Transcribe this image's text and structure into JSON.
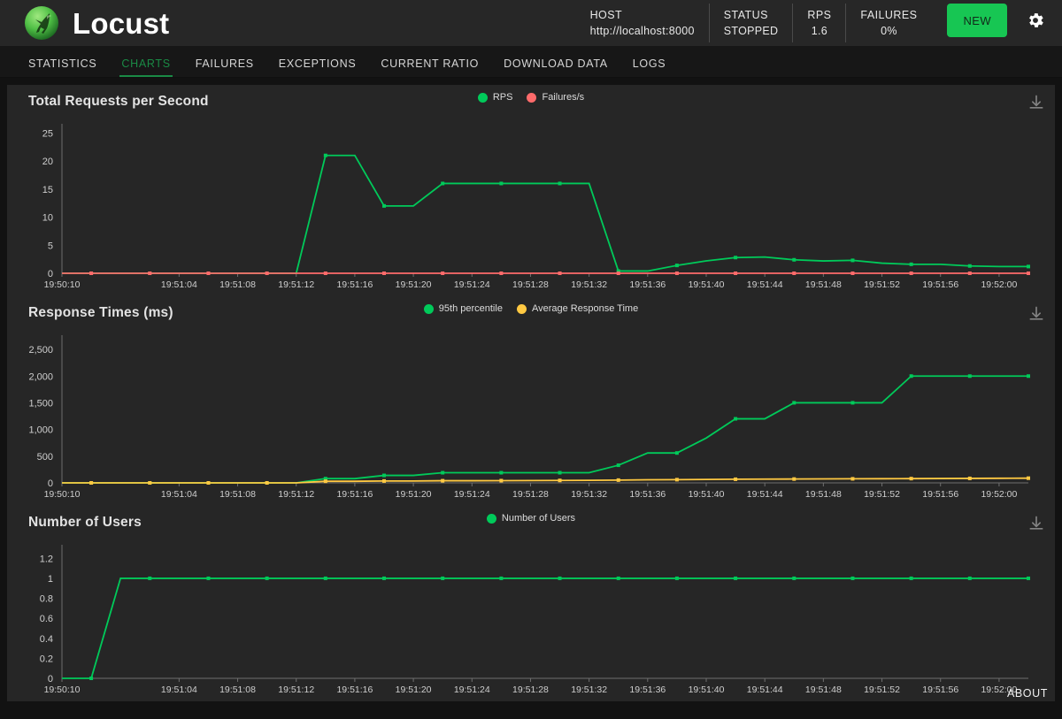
{
  "app": {
    "brand": "Locust",
    "logo_icon": "locust-logo-icon"
  },
  "header": {
    "stats": [
      {
        "label": "HOST",
        "value": "http://localhost:8000",
        "align": "left"
      },
      {
        "label": "STATUS",
        "value": "STOPPED",
        "align": "left"
      },
      {
        "label": "RPS",
        "value": "1.6",
        "align": "center"
      },
      {
        "label": "FAILURES",
        "value": "0%",
        "align": "center"
      }
    ],
    "new_button": "NEW",
    "settings_icon": "gear-icon"
  },
  "nav": {
    "tabs": [
      {
        "label": "STATISTICS",
        "active": false
      },
      {
        "label": "CHARTS",
        "active": true
      },
      {
        "label": "FAILURES",
        "active": false
      },
      {
        "label": "EXCEPTIONS",
        "active": false
      },
      {
        "label": "CURRENT RATIO",
        "active": false
      },
      {
        "label": "DOWNLOAD DATA",
        "active": false
      },
      {
        "label": "LOGS",
        "active": false
      }
    ]
  },
  "footer": {
    "about_label": "ABOUT"
  },
  "colors": {
    "green": "#00ca5a",
    "red": "#ff6b6b",
    "amber": "#ffc942",
    "panel_bg": "#262626",
    "page_bg": "#121212",
    "axis": "#8a8a8a",
    "tick_text": "#cfcfcf"
  },
  "download_icon": "download-icon",
  "chart_data": [
    {
      "id": "rps",
      "type": "line",
      "title": "Total Requests per Second",
      "xlabel": "",
      "ylabel": "",
      "ylim": [
        0,
        26
      ],
      "yticks": [
        0,
        5,
        10,
        15,
        20,
        25
      ],
      "ytick_labels": [
        "0",
        "5",
        "10",
        "15",
        "20",
        "25"
      ],
      "grid": false,
      "legend_position": "top-center",
      "x": [
        "19:50:10",
        "19:50:12",
        "19:51:00",
        "19:51:02",
        "19:51:04",
        "19:51:06",
        "19:51:08",
        "19:51:10",
        "19:51:12",
        "19:51:14",
        "19:51:16",
        "19:51:18",
        "19:51:20",
        "19:51:22",
        "19:51:24",
        "19:51:26",
        "19:51:28",
        "19:51:30",
        "19:51:32",
        "19:51:34",
        "19:51:36",
        "19:51:38",
        "19:51:40",
        "19:51:42",
        "19:51:44",
        "19:51:46",
        "19:51:48",
        "19:51:50",
        "19:51:52",
        "19:51:54",
        "19:51:56",
        "19:51:58",
        "19:52:00",
        "19:52:02"
      ],
      "xtick_labels": [
        "19:50:10",
        "19:51:04",
        "19:51:08",
        "19:51:12",
        "19:51:16",
        "19:51:20",
        "19:51:24",
        "19:51:28",
        "19:51:32",
        "19:51:36",
        "19:51:40",
        "19:51:44",
        "19:51:48",
        "19:51:52",
        "19:51:56",
        "19:52:00"
      ],
      "xtick_indices": [
        0,
        4,
        6,
        8,
        10,
        12,
        14,
        16,
        18,
        20,
        22,
        24,
        26,
        28,
        30,
        32
      ],
      "series": [
        {
          "name": "RPS",
          "color": "#00ca5a",
          "values": [
            0,
            0,
            0,
            0,
            0,
            0,
            0,
            0,
            0,
            21,
            21,
            12,
            12,
            16,
            16,
            16,
            16,
            16,
            16,
            0.4,
            0.4,
            1.4,
            2.2,
            2.8,
            2.9,
            2.4,
            2.2,
            2.3,
            1.8,
            1.6,
            1.6,
            1.3,
            1.2,
            1.2
          ]
        },
        {
          "name": "Failures/s",
          "color": "#ff6b6b",
          "values": [
            0,
            0,
            0,
            0,
            0,
            0,
            0,
            0,
            0,
            0,
            0,
            0,
            0,
            0,
            0,
            0,
            0,
            0,
            0,
            0,
            0,
            0,
            0,
            0,
            0,
            0,
            0,
            0,
            0,
            0,
            0,
            0,
            0,
            0
          ]
        }
      ]
    },
    {
      "id": "response_times",
      "type": "line",
      "title": "Response Times (ms)",
      "xlabel": "",
      "ylabel": "",
      "ylim": [
        0,
        2700
      ],
      "yticks": [
        0,
        500,
        1000,
        1500,
        2000,
        2500
      ],
      "ytick_labels": [
        "0",
        "500",
        "1,000",
        "1,500",
        "2,000",
        "2,500"
      ],
      "grid": false,
      "legend_position": "top-center",
      "x": [
        "19:50:10",
        "19:50:12",
        "19:51:00",
        "19:51:02",
        "19:51:04",
        "19:51:06",
        "19:51:08",
        "19:51:10",
        "19:51:12",
        "19:51:14",
        "19:51:16",
        "19:51:18",
        "19:51:20",
        "19:51:22",
        "19:51:24",
        "19:51:26",
        "19:51:28",
        "19:51:30",
        "19:51:32",
        "19:51:34",
        "19:51:36",
        "19:51:38",
        "19:51:40",
        "19:51:42",
        "19:51:44",
        "19:51:46",
        "19:51:48",
        "19:51:50",
        "19:51:52",
        "19:51:54",
        "19:51:56",
        "19:51:58",
        "19:52:00",
        "19:52:02"
      ],
      "xtick_labels": [
        "19:50:10",
        "19:51:04",
        "19:51:08",
        "19:51:12",
        "19:51:16",
        "19:51:20",
        "19:51:24",
        "19:51:28",
        "19:51:32",
        "19:51:36",
        "19:51:40",
        "19:51:44",
        "19:51:48",
        "19:51:52",
        "19:51:56",
        "19:52:00"
      ],
      "xtick_indices": [
        0,
        4,
        6,
        8,
        10,
        12,
        14,
        16,
        18,
        20,
        22,
        24,
        26,
        28,
        30,
        32
      ],
      "series": [
        {
          "name": "95th percentile",
          "color": "#00ca5a",
          "values": [
            0,
            0,
            0,
            0,
            0,
            0,
            0,
            0,
            0,
            80,
            80,
            140,
            140,
            190,
            190,
            190,
            190,
            190,
            190,
            330,
            560,
            560,
            840,
            1200,
            1200,
            1500,
            1500,
            1500,
            1500,
            2000,
            2000,
            2000,
            2000,
            2000
          ]
        },
        {
          "name": "Average Response Time",
          "color": "#ffc942",
          "values": [
            0,
            0,
            0,
            0,
            0,
            0,
            0,
            0,
            0,
            30,
            30,
            35,
            35,
            40,
            40,
            42,
            44,
            46,
            48,
            52,
            58,
            60,
            64,
            68,
            70,
            72,
            74,
            76,
            78,
            80,
            82,
            84,
            86,
            88
          ]
        }
      ]
    },
    {
      "id": "users",
      "type": "line",
      "title": "Number of Users",
      "xlabel": "",
      "ylabel": "",
      "ylim": [
        0,
        1.3
      ],
      "yticks": [
        0,
        0.2,
        0.4,
        0.6,
        0.8,
        1,
        1.2
      ],
      "ytick_labels": [
        "0",
        "0.2",
        "0.4",
        "0.6",
        "0.8",
        "1",
        "1.2"
      ],
      "grid": false,
      "legend_position": "top-center",
      "x": [
        "19:50:10",
        "19:50:12",
        "19:51:00",
        "19:51:02",
        "19:51:04",
        "19:51:06",
        "19:51:08",
        "19:51:10",
        "19:51:12",
        "19:51:14",
        "19:51:16",
        "19:51:18",
        "19:51:20",
        "19:51:22",
        "19:51:24",
        "19:51:26",
        "19:51:28",
        "19:51:30",
        "19:51:32",
        "19:51:34",
        "19:51:36",
        "19:51:38",
        "19:51:40",
        "19:51:42",
        "19:51:44",
        "19:51:46",
        "19:51:48",
        "19:51:50",
        "19:51:52",
        "19:51:54",
        "19:51:56",
        "19:51:58",
        "19:52:00",
        "19:52:02"
      ],
      "xtick_labels": [
        "19:50:10",
        "19:51:04",
        "19:51:08",
        "19:51:12",
        "19:51:16",
        "19:51:20",
        "19:51:24",
        "19:51:28",
        "19:51:32",
        "19:51:36",
        "19:51:40",
        "19:51:44",
        "19:51:48",
        "19:51:52",
        "19:51:56",
        "19:52:00"
      ],
      "xtick_indices": [
        0,
        4,
        6,
        8,
        10,
        12,
        14,
        16,
        18,
        20,
        22,
        24,
        26,
        28,
        30,
        32
      ],
      "series": [
        {
          "name": "Number of Users",
          "color": "#00ca5a",
          "values": [
            0,
            0,
            1,
            1,
            1,
            1,
            1,
            1,
            1,
            1,
            1,
            1,
            1,
            1,
            1,
            1,
            1,
            1,
            1,
            1,
            1,
            1,
            1,
            1,
            1,
            1,
            1,
            1,
            1,
            1,
            1,
            1,
            1,
            1
          ]
        }
      ]
    }
  ]
}
